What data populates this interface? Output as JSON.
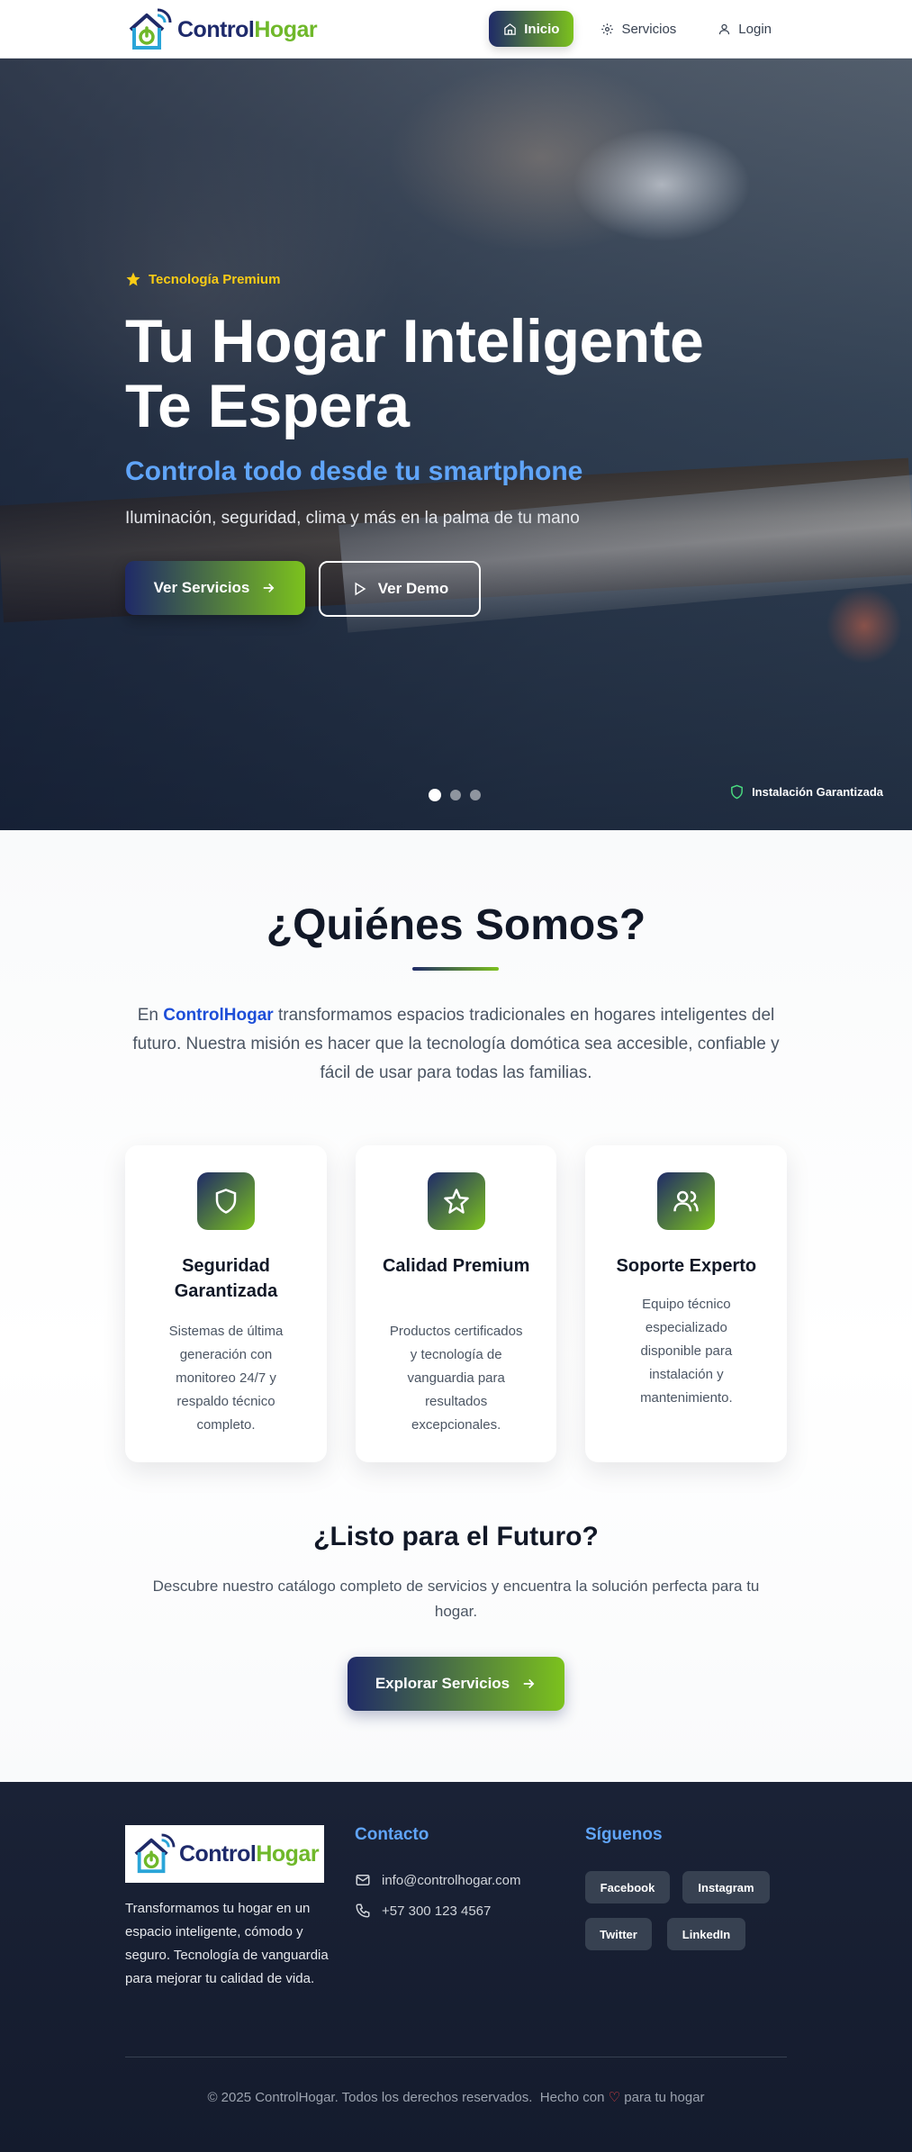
{
  "nav": {
    "brand_part1": "Control",
    "brand_part2": "Hogar",
    "links": [
      {
        "label": "Inicio",
        "icon": "home-icon",
        "active": true
      },
      {
        "label": "Servicios",
        "icon": "gear-icon",
        "active": false
      },
      {
        "label": "Login",
        "icon": "user-icon",
        "active": false
      }
    ]
  },
  "hero": {
    "badge": "Tecnología Premium",
    "title_line1": "Tu Hogar Inteligente",
    "title_line2": "Te Espera",
    "subtitle": "Controla todo desde tu smartphone",
    "description": "Iluminación, seguridad, clima y más en la palma de tu mano",
    "primary_button": "Ver Servicios",
    "secondary_button": "Ver Demo",
    "slides": 3,
    "active_slide": 1,
    "guarantee": "Instalación Garantizada"
  },
  "about": {
    "title": "¿Quiénes Somos?",
    "text_prefix": "En ",
    "brand": "ControlHogar",
    "text_rest": " transformamos espacios tradicionales en hogares inteligentes del futuro. Nuestra misión es hacer que la tecnología domótica sea accesible, confiable y fácil de usar para todas las familias.",
    "cards": [
      {
        "icon": "shield-icon",
        "title": "Seguridad Garantizada",
        "description": "Sistemas de última generación con monitoreo 24/7 y respaldo técnico completo."
      },
      {
        "icon": "star-icon",
        "title": "Calidad Premium",
        "description": "Productos certificados y tecnología de vanguardia para resultados excepcionales."
      },
      {
        "icon": "users-icon",
        "title": "Soporte Experto",
        "description": "Equipo técnico especializado disponible para instalación y mantenimiento."
      }
    ],
    "cta_title": "¿Listo para el Futuro?",
    "cta_text": "Descubre nuestro catálogo completo de servicios y encuentra la solución perfecta para tu hogar.",
    "cta_button": "Explorar Servicios"
  },
  "footer": {
    "brand_part1": "Control",
    "brand_part2": "Hogar",
    "about": "Transformamos tu hogar en un espacio inteligente, cómodo y seguro. Tecnología de vanguardia para mejorar tu calidad de vida.",
    "contact_title": "Contacto",
    "email": "info@controlhogar.com",
    "phone": "+57 300 123 4567",
    "social_title": "Síguenos",
    "social": [
      "Facebook",
      "Instagram",
      "Twitter",
      "LinkedIn"
    ],
    "copyright": "© 2025 ControlHogar. Todos los derechos reservados.",
    "made_with": "Hecho con",
    "made_for": "para tu hogar"
  },
  "colors": {
    "brand_navy": "#1f2a68",
    "brand_green": "#7cc21d",
    "accent_blue": "#60a5fa",
    "badge_yellow": "#facc15"
  }
}
